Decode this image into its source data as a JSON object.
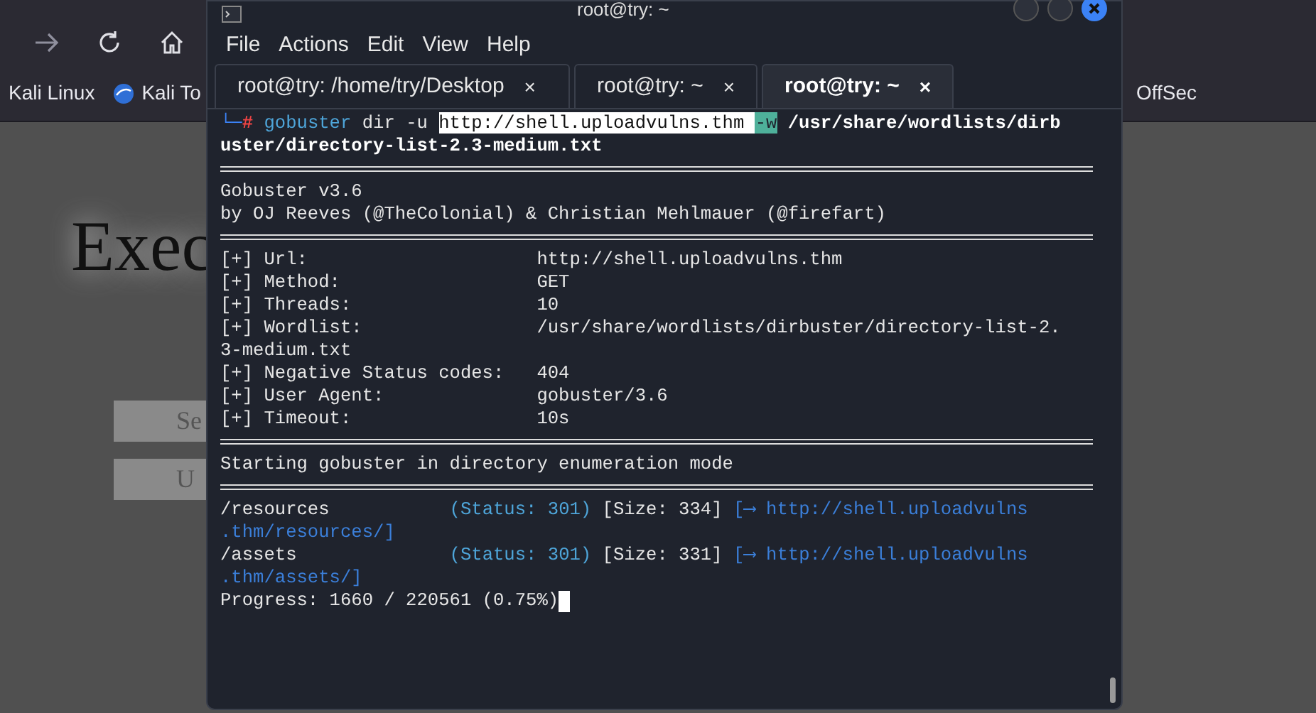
{
  "browser": {
    "bookmarks_left": [
      "Kali Linux",
      "Kali To"
    ],
    "bookmarks_right": [
      "OffSec"
    ],
    "page": {
      "heading": "Exec",
      "buttons": [
        "Se",
        "U"
      ]
    }
  },
  "terminal": {
    "title": "root@try: ~",
    "menu": [
      "File",
      "Actions",
      "Edit",
      "View",
      "Help"
    ],
    "tabs": [
      {
        "label": "root@try: /home/try/Desktop",
        "close": "×",
        "selected": false
      },
      {
        "label": "root@try: ~",
        "close": "×",
        "selected": false
      },
      {
        "label": "root@try: ~",
        "close": "×",
        "selected": true
      }
    ],
    "lines": [
      {
        "kind": "text",
        "segments": [
          {
            "text": "└─",
            "kind": "prompt"
          },
          {
            "text": "#",
            "kind": "root"
          },
          {
            "text": " gobuster",
            "kind": "command"
          },
          {
            "text": " dir -u ",
            "kind": "plain"
          },
          {
            "text": "http://shell.uploadvulns.thm ",
            "kind": "selected"
          },
          {
            "text": "-w",
            "kind": "flag-selected"
          },
          {
            "text": " /usr/share/wordlists/dirb",
            "kind": "bold"
          }
        ]
      },
      {
        "kind": "text",
        "segments": [
          {
            "text": "uster/directory-list-2.3-medium.txt",
            "kind": "bold"
          }
        ]
      },
      {
        "kind": "rule"
      },
      {
        "kind": "text",
        "segments": [
          {
            "text": "Gobuster v3.6",
            "kind": "plain"
          }
        ]
      },
      {
        "kind": "text",
        "segments": [
          {
            "text": "by OJ Reeves (@TheColonial) & Christian Mehlmauer (@firefart)",
            "kind": "plain"
          }
        ]
      },
      {
        "kind": "rule"
      },
      {
        "kind": "text",
        "segments": [
          {
            "text": "[+] Url:                     http://shell.uploadvulns.thm",
            "kind": "plain"
          }
        ]
      },
      {
        "kind": "text",
        "segments": [
          {
            "text": "[+] Method:                  GET",
            "kind": "plain"
          }
        ]
      },
      {
        "kind": "text",
        "segments": [
          {
            "text": "[+] Threads:                 10",
            "kind": "plain"
          }
        ]
      },
      {
        "kind": "text",
        "segments": [
          {
            "text": "[+] Wordlist:                /usr/share/wordlists/dirbuster/directory-list-2.",
            "kind": "plain"
          }
        ]
      },
      {
        "kind": "text",
        "segments": [
          {
            "text": "3-medium.txt",
            "kind": "plain"
          }
        ]
      },
      {
        "kind": "text",
        "segments": [
          {
            "text": "[+] Negative Status codes:   404",
            "kind": "plain"
          }
        ]
      },
      {
        "kind": "text",
        "segments": [
          {
            "text": "[+] User Agent:              gobuster/3.6",
            "kind": "plain"
          }
        ]
      },
      {
        "kind": "text",
        "segments": [
          {
            "text": "[+] Timeout:                 10s",
            "kind": "plain"
          }
        ]
      },
      {
        "kind": "rule"
      },
      {
        "kind": "text",
        "segments": [
          {
            "text": "Starting gobuster in directory enumeration mode",
            "kind": "plain"
          }
        ]
      },
      {
        "kind": "rule"
      },
      {
        "kind": "text",
        "segments": [
          {
            "text": "/resources           ",
            "kind": "plain"
          },
          {
            "text": "(Status: 301)",
            "kind": "status"
          },
          {
            "text": " [Size: 334] ",
            "kind": "plain"
          },
          {
            "text": "[⟶ http://shell.uploadvulns",
            "kind": "link"
          }
        ]
      },
      {
        "kind": "text",
        "segments": [
          {
            "text": ".thm/resources/]",
            "kind": "link"
          }
        ]
      },
      {
        "kind": "text",
        "segments": [
          {
            "text": "/assets              ",
            "kind": "plain"
          },
          {
            "text": "(Status: 301)",
            "kind": "status"
          },
          {
            "text": " [Size: 331] ",
            "kind": "plain"
          },
          {
            "text": "[⟶ http://shell.uploadvulns",
            "kind": "link"
          }
        ]
      },
      {
        "kind": "text",
        "segments": [
          {
            "text": ".thm/assets/]",
            "kind": "link"
          }
        ]
      },
      {
        "kind": "text",
        "cursor": true,
        "segments": [
          {
            "text": "Progress: 1660 / 220561 (0.75%)",
            "kind": "plain"
          }
        ]
      }
    ]
  }
}
